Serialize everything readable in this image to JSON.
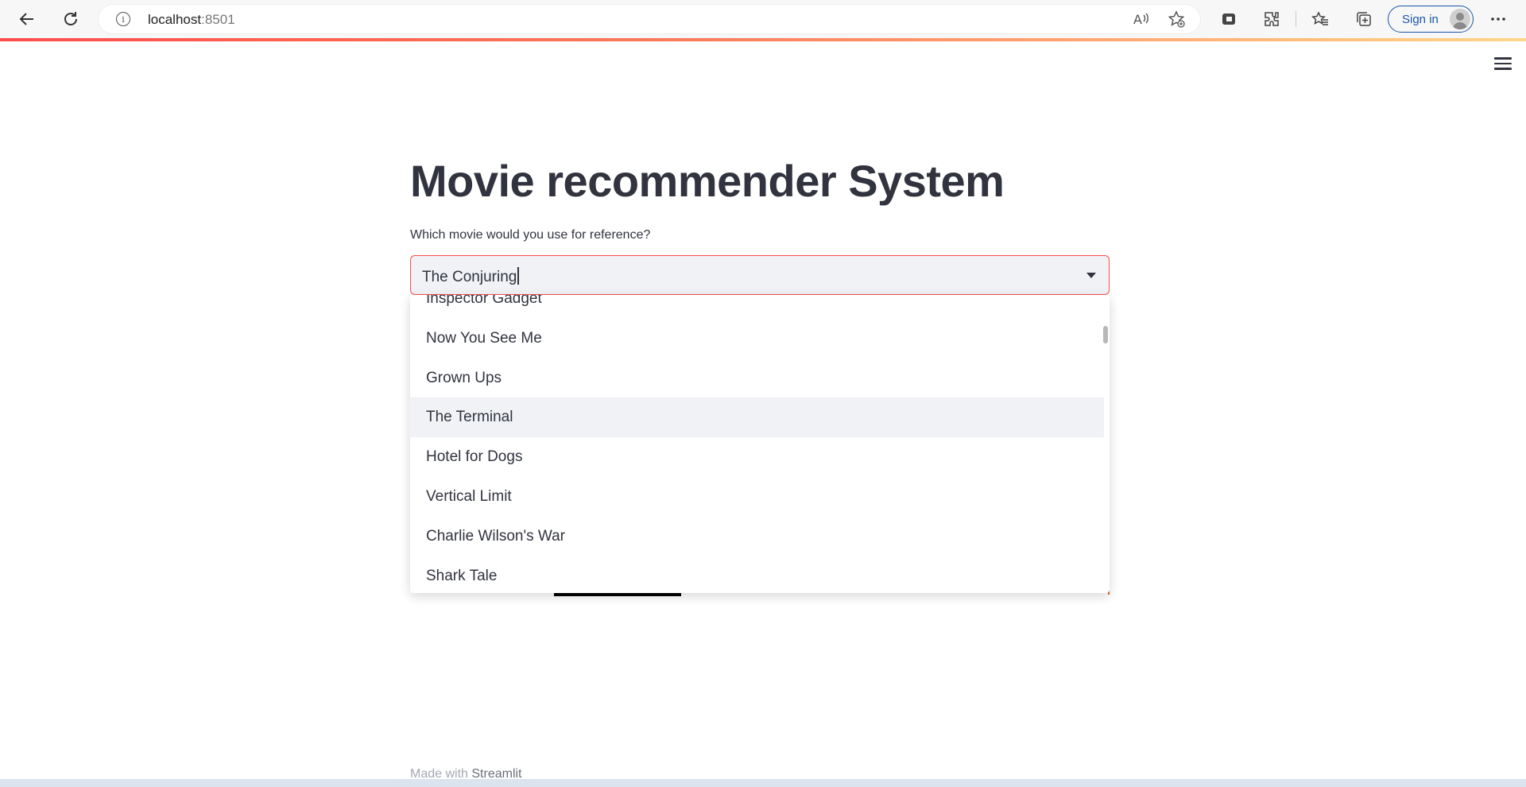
{
  "browser": {
    "url_host": "localhost",
    "url_port": ":8501",
    "sign_in_label": "Sign in"
  },
  "app": {
    "title": "Movie recommender System",
    "select_label": "Which movie would you use for reference?",
    "select_value": "The Conjuring",
    "options": [
      "Inspector Gadget",
      "Now You See Me",
      "Grown Ups",
      "The Terminal",
      "Hotel for Dogs",
      "Vertical Limit",
      "Charlie Wilson's War",
      "Shark Tale"
    ],
    "highlighted_option": "The Terminal",
    "footer_prefix": "Made with ",
    "footer_brand": "Streamlit"
  },
  "colors": {
    "accent": "#ff4b4b",
    "text": "#31333f",
    "select_bg": "#f0f2f6"
  }
}
